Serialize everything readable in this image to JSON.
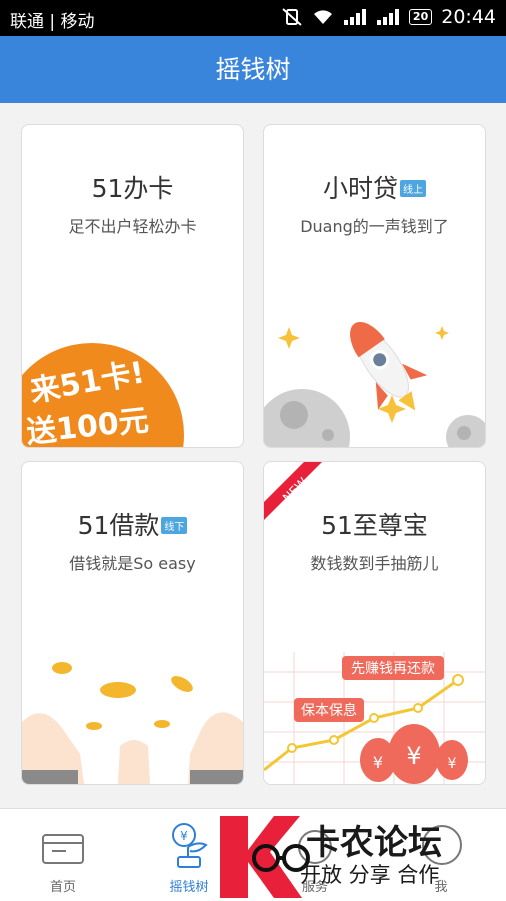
{
  "status_bar": {
    "carrier": "联通 | 移动",
    "battery": "20",
    "time": "20:44"
  },
  "app_bar": {
    "title": "摇钱树"
  },
  "cards": [
    {
      "title": "51办卡",
      "subtitle": "足不出户轻松办卡",
      "badge_line1": "来51卡!",
      "badge_line2": "送100元"
    },
    {
      "title": "小时贷",
      "tag": "线上",
      "subtitle": "Duang的一声钱到了"
    },
    {
      "title": "51借款",
      "tag": "线下",
      "subtitle": "借钱就是So easy"
    },
    {
      "title": "51至尊宝",
      "ribbon": "NEW",
      "subtitle": "数钱数到手抽筋儿",
      "chart_label_1": "先赚钱再还款",
      "chart_label_2": "保本保息",
      "currency": "¥"
    }
  ],
  "tabs": [
    {
      "label": "首页"
    },
    {
      "label": "摇钱树"
    },
    {
      "label": "服务"
    },
    {
      "label": "我"
    }
  ],
  "watermark": {
    "title": "卡农论坛",
    "subtitle": "开放 分享 合作"
  },
  "colors": {
    "primary": "#3a85dc",
    "accent_orange": "#f08a1c",
    "tag_blue": "#4ea6e0",
    "ribbon_red": "#e8203a"
  }
}
